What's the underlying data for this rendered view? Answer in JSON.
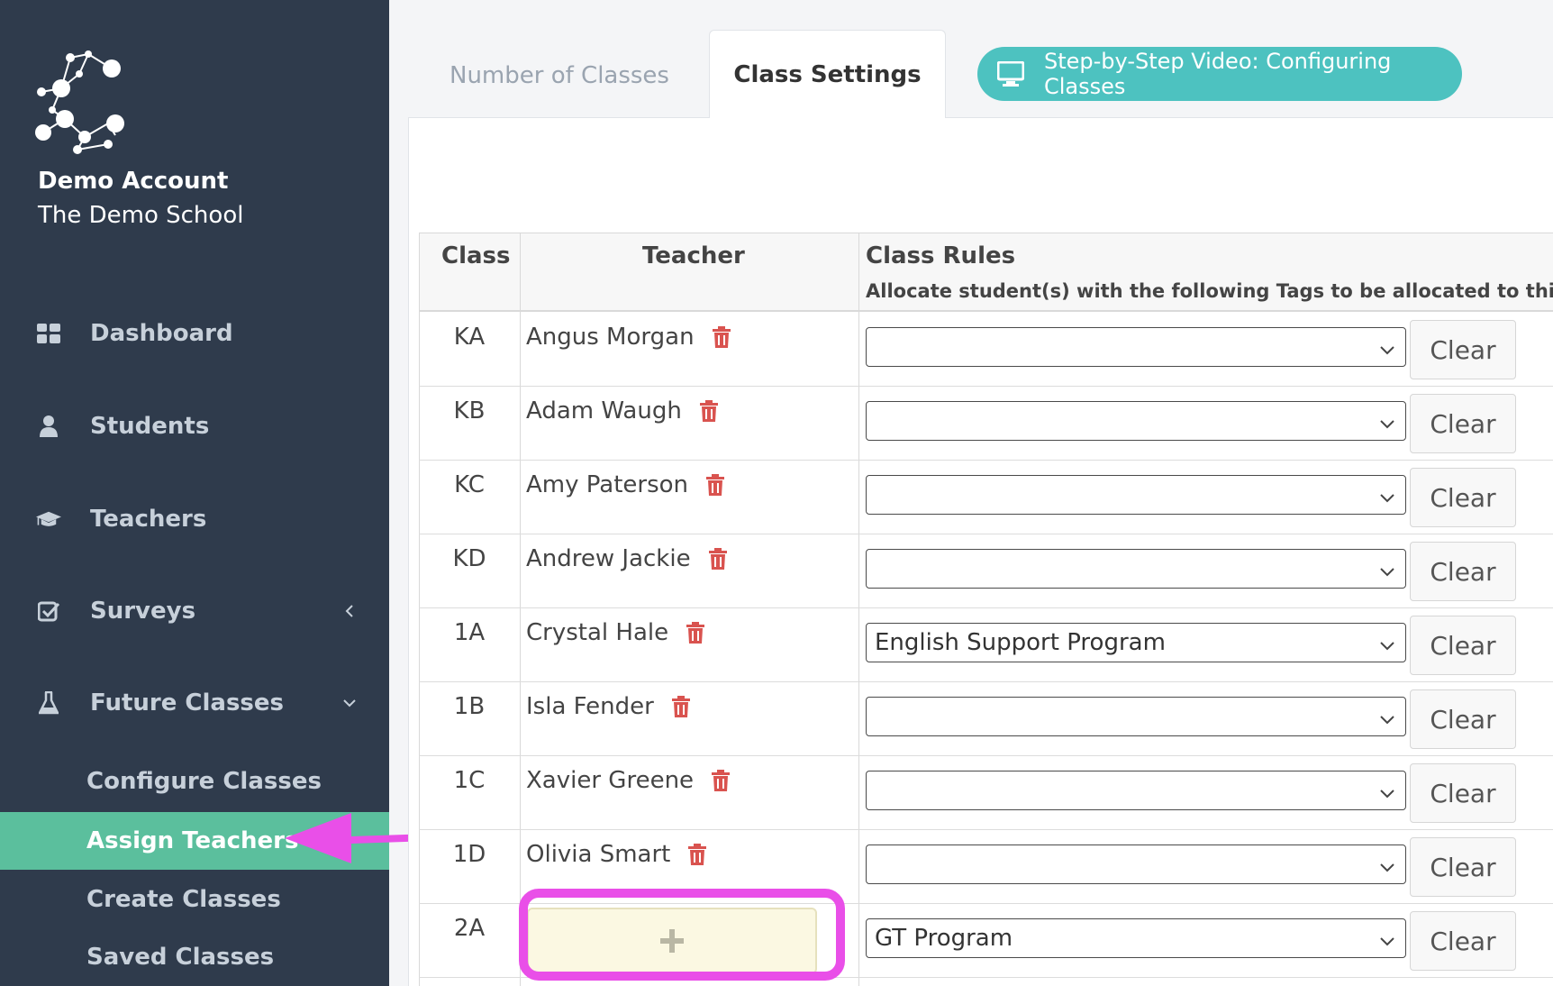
{
  "sidebar": {
    "account_name": "Demo Account",
    "school_name": "The Demo School",
    "nav": [
      {
        "label": "Dashboard",
        "icon": "dashboard-icon"
      },
      {
        "label": "Students",
        "icon": "user-icon"
      },
      {
        "label": "Teachers",
        "icon": "graduation-cap-icon"
      },
      {
        "label": "Surveys",
        "icon": "checkbox-icon",
        "chevron": "chevron-left-icon"
      },
      {
        "label": "Future Classes",
        "icon": "flask-icon",
        "chevron": "chevron-down-icon"
      }
    ],
    "sub_items": [
      {
        "label": "Configure Classes"
      },
      {
        "label": "Assign Teachers",
        "active": true
      },
      {
        "label": "Create Classes"
      },
      {
        "label": "Saved Classes"
      }
    ]
  },
  "tabs": {
    "number_of_classes": "Number of Classes",
    "class_settings": "Class Settings"
  },
  "video_button": {
    "label": "Step-by-Step Video: Configuring Classes",
    "icon": "monitor-icon"
  },
  "table": {
    "headers": {
      "class": "Class",
      "teacher": "Teacher",
      "rules": "Class Rules",
      "rules_sub": "Allocate student(s) with the following Tags to be allocated to this clas"
    },
    "clear_label": "Clear",
    "add_icon": "plus-icon",
    "rows": [
      {
        "class": "KA",
        "teacher": "Angus Morgan",
        "rule": ""
      },
      {
        "class": "KB",
        "teacher": "Adam Waugh",
        "rule": ""
      },
      {
        "class": "KC",
        "teacher": "Amy Paterson",
        "rule": ""
      },
      {
        "class": "KD",
        "teacher": "Andrew Jackie",
        "rule": ""
      },
      {
        "class": "1A",
        "teacher": "Crystal Hale",
        "rule": "English Support Program"
      },
      {
        "class": "1B",
        "teacher": "Isla Fender",
        "rule": ""
      },
      {
        "class": "1C",
        "teacher": "Xavier Greene",
        "rule": ""
      },
      {
        "class": "1D",
        "teacher": "Olivia Smart",
        "rule": ""
      },
      {
        "class": "2A",
        "teacher": "",
        "rule": "GT Program"
      }
    ]
  },
  "colors": {
    "sidebar_bg": "#2f3b4c",
    "active_bg": "#5bbf9d",
    "video_btn": "#4dc2c0",
    "trash": "#d9534f",
    "annotation": "#e94fe8"
  }
}
